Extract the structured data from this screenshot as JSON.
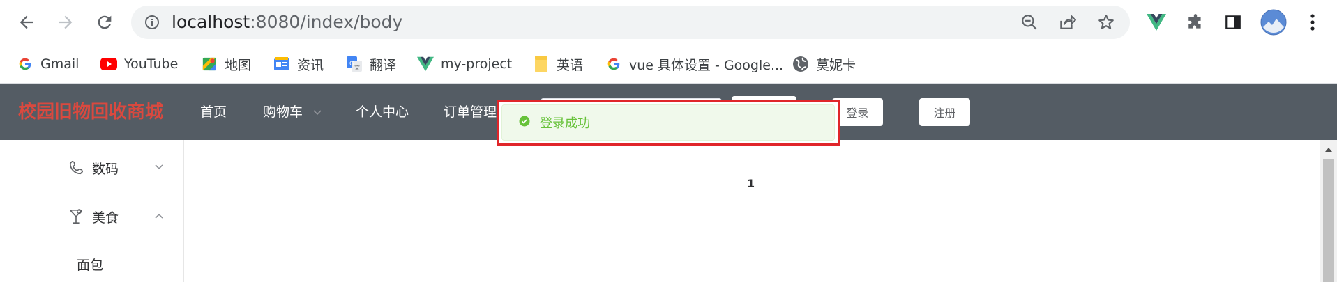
{
  "browser": {
    "url_host": "localhost",
    "url_port_path": ":8080/index/body",
    "icons": [
      "back-icon",
      "forward-icon",
      "reload-icon",
      "info-icon",
      "zoom-out-icon",
      "share-icon",
      "star-icon",
      "vue-devtools-icon",
      "extensions-icon",
      "side-panel-icon",
      "profile-avatar",
      "menu-icon"
    ]
  },
  "bookmarks": [
    {
      "label": "Gmail",
      "icon": "google-icon"
    },
    {
      "label": "YouTube",
      "icon": "youtube-icon"
    },
    {
      "label": "地图",
      "icon": "maps-icon"
    },
    {
      "label": "资讯",
      "icon": "news-icon"
    },
    {
      "label": "翻译",
      "icon": "translate-icon"
    },
    {
      "label": "my-project",
      "icon": "vue-icon"
    },
    {
      "label": "英语",
      "icon": "folder-icon"
    },
    {
      "label": "vue 具体设置 - Google...",
      "icon": "google-icon"
    },
    {
      "label": "莫妮卡",
      "icon": "globe-icon"
    }
  ],
  "header": {
    "site_title": "校园旧物回收商城",
    "menu": [
      "首页",
      "购物车",
      "个人中心",
      "订单管理"
    ],
    "login": "登录",
    "register": "注册"
  },
  "sidebar": {
    "items": [
      {
        "label": "数码",
        "icon": "phone-icon",
        "expanded": false
      },
      {
        "label": "美食",
        "icon": "cocktail-icon",
        "expanded": true
      }
    ],
    "sub_items": [
      "面包"
    ]
  },
  "main": {
    "page_number": "1"
  },
  "toast": {
    "message": "登录成功",
    "type": "success"
  },
  "colors": {
    "header_bg": "#545c64",
    "title": "#d9493f",
    "toast_text": "#67c23a",
    "toast_bg": "#f0f9eb",
    "highlight_border": "#e0262a"
  }
}
